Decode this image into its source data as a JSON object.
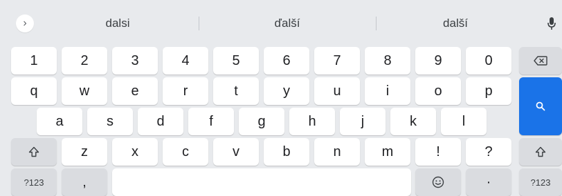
{
  "suggestions": {
    "expand_icon": "chevron-right-icon",
    "items": [
      "dalsi",
      "ďalší",
      "další"
    ],
    "mic_icon": "microphone-icon"
  },
  "rows": {
    "numbers": [
      "1",
      "2",
      "3",
      "4",
      "5",
      "6",
      "7",
      "8",
      "9",
      "0"
    ],
    "row1": [
      "q",
      "w",
      "e",
      "r",
      "t",
      "y",
      "u",
      "i",
      "o",
      "p"
    ],
    "row2": [
      "a",
      "s",
      "d",
      "f",
      "g",
      "h",
      "j",
      "k",
      "l"
    ],
    "row3": [
      "z",
      "x",
      "c",
      "v",
      "b",
      "n",
      "m",
      "!",
      "?"
    ]
  },
  "special": {
    "backspace_icon": "backspace-icon",
    "search_icon": "search-icon",
    "shift_icon": "shift-icon",
    "symbols_left": "?123",
    "comma": ",",
    "emoji_icon": "emoji-icon",
    "period": "·",
    "symbols_right": "?123"
  },
  "colors": {
    "background": "#e8eaed",
    "key": "#ffffff",
    "key_function": "#dadce0",
    "accent": "#1a73e8"
  }
}
